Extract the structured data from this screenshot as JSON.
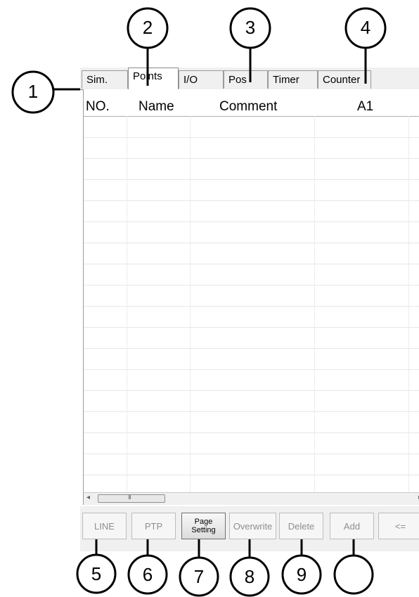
{
  "tabs": [
    {
      "label": "Sim.",
      "active": false
    },
    {
      "label": "Points",
      "active": true
    },
    {
      "label": "I/O",
      "active": false
    },
    {
      "label": "Pos",
      "active": false
    },
    {
      "label": "Timer",
      "active": false
    },
    {
      "label": "Counter",
      "active": false
    }
  ],
  "table": {
    "headers": [
      "NO.",
      "Name",
      "Comment",
      "A1"
    ],
    "rows": []
  },
  "scrollbar": {
    "left_arrow": "◂",
    "thumb_grip": "III",
    "right_arrow": "▸"
  },
  "buttons": [
    {
      "label": "LINE",
      "enabled": false
    },
    {
      "label": "PTP",
      "enabled": false
    },
    {
      "label": "Page Setting",
      "enabled": true
    },
    {
      "label": "Overwrite",
      "enabled": false
    },
    {
      "label": "Delete",
      "enabled": false
    },
    {
      "label": "Add",
      "enabled": false
    },
    {
      "label": "<=",
      "enabled": false
    }
  ],
  "callouts": [
    "1",
    "2",
    "3",
    "4",
    "5",
    "6",
    "7",
    "8",
    "9",
    ""
  ]
}
